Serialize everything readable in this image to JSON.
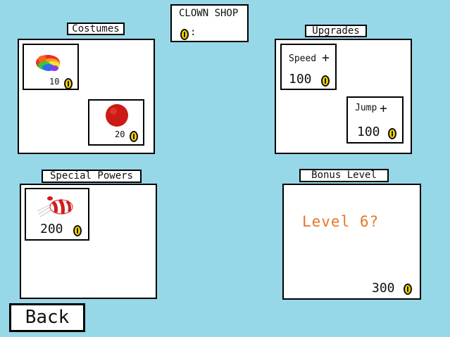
{
  "shop": {
    "title": "CLOWN SHOP",
    "coins_label": ":"
  },
  "costumes": {
    "header": "Costumes",
    "items": [
      {
        "name": "rainbow-wig",
        "icon": "rainbow-wig-icon",
        "price": "10"
      },
      {
        "name": "red-nose",
        "icon": "red-nose-icon",
        "price": "20"
      }
    ]
  },
  "upgrades": {
    "header": "Upgrades",
    "items": [
      {
        "name": "speed",
        "label": "Speed",
        "plus": "+",
        "price": "100"
      },
      {
        "name": "jump",
        "label": "Jump",
        "plus": "+",
        "price": "100"
      }
    ]
  },
  "special_powers": {
    "header": "Special Powers",
    "items": [
      {
        "name": "clown-cannon",
        "icon": "striped-rocket-icon",
        "price": "200"
      }
    ]
  },
  "bonus_level": {
    "header": "Bonus Level",
    "text": "Level 6?",
    "price": "300"
  },
  "back_label": "Back",
  "colors": {
    "background": "#96d7e8",
    "coin": "#f6d600",
    "bonus_text": "#e8762a",
    "nose": "#cc1a14"
  }
}
